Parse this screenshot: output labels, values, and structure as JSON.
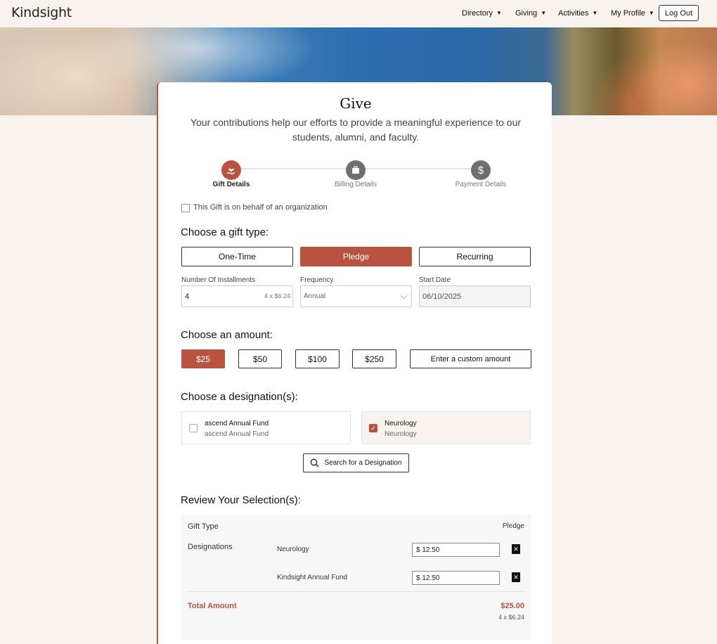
{
  "header": {
    "logo": "Kindsight",
    "nav": [
      {
        "label": "Directory"
      },
      {
        "label": "Giving"
      },
      {
        "label": "Activities"
      },
      {
        "label": "My Profile"
      }
    ],
    "logout": "Log Out"
  },
  "form": {
    "title": "Give",
    "subtitle": "Your contributions help our efforts to provide a meaningful experience to our students, alumni, and faculty.",
    "steps": [
      {
        "label": "Gift Details",
        "icon": "hand-heart-icon",
        "active": true
      },
      {
        "label": "Billing Details",
        "icon": "briefcase-icon",
        "active": false
      },
      {
        "label": "Payment Details",
        "icon": "dollar-icon",
        "active": false
      }
    ],
    "org_checkbox": "This Gift is on behalf of an organization",
    "gift_type_heading": "Choose a gift type:",
    "gift_types": [
      "One-Time",
      "Pledge",
      "Recurring"
    ],
    "selected_gift_type": "Pledge",
    "installments_label": "Number Of Installments",
    "installments_value": "4",
    "installments_hint": "4 x $6.24",
    "frequency_label": "Frequency",
    "frequency_value": "Annual",
    "start_date_label": "Start Date",
    "start_date_value": "06/10/2025",
    "amount_heading": "Choose an amount:",
    "amounts": [
      "$25",
      "$50",
      "$100",
      "$250"
    ],
    "selected_amount": "$25",
    "custom_amount": "Enter a custom amount",
    "designation_heading": "Choose a designation(s):",
    "designations": [
      {
        "name": "ascend Annual Fund",
        "sub": "ascend Annual Fund",
        "checked": false
      },
      {
        "name": "Neurology",
        "sub": "Neurology",
        "checked": true
      }
    ],
    "search_designation": "Search for a Designation",
    "review_heading": "Review Your Selection(s):",
    "review": {
      "gift_type_label": "Gift Type",
      "gift_type_value": "Pledge",
      "designations_label": "Designations",
      "lines": [
        {
          "name": "Neurology",
          "amount": "$ 12.50"
        },
        {
          "name": "Kindsight Annual Fund",
          "amount": "$ 12.50"
        }
      ],
      "total_label": "Total Amount",
      "total_value": "$25.00",
      "total_sub": "4 x $6.24"
    }
  },
  "colors": {
    "accent": "#b9533f",
    "background": "#f9f3ef"
  }
}
